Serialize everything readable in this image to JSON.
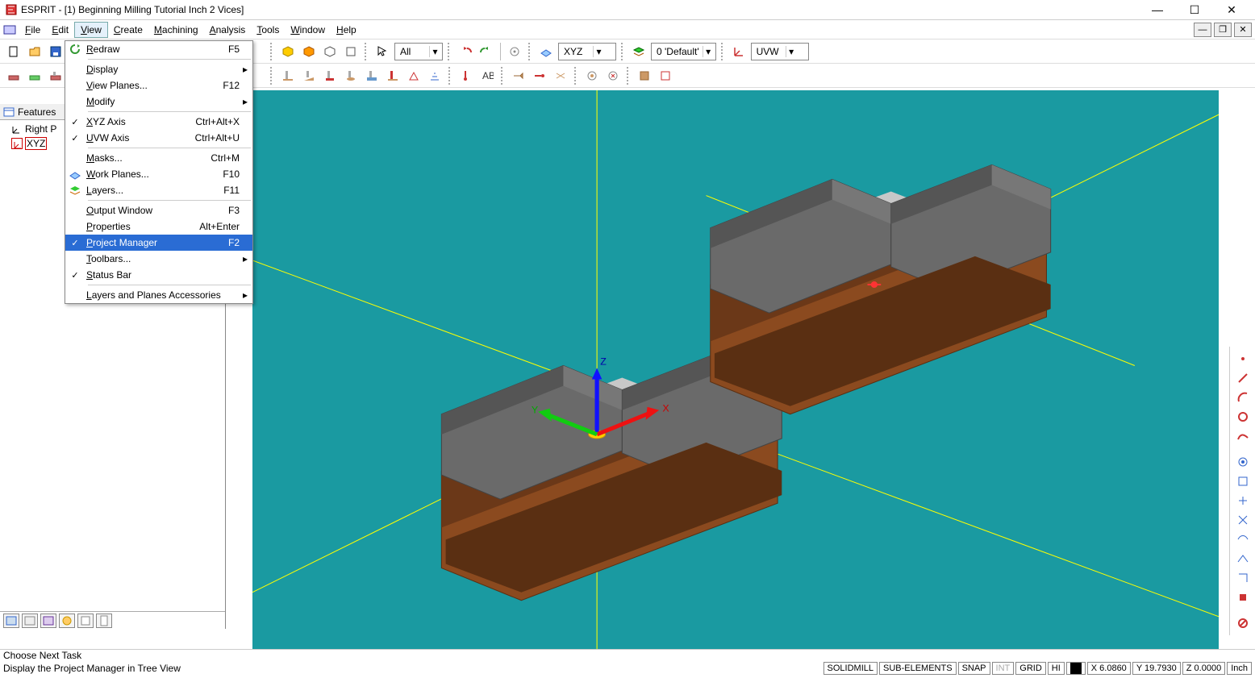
{
  "title": "ESPRIT - [1) Beginning Milling Tutorial Inch 2 Vices]",
  "menubar": [
    "File",
    "Edit",
    "View",
    "Create",
    "Machining",
    "Analysis",
    "Tools",
    "Window",
    "Help"
  ],
  "toolbar1": {
    "filter_combo": "All",
    "plane_combo": "XYZ",
    "layer_combo": "0 'Default'",
    "uvw_combo": "UVW"
  },
  "features": {
    "header": "Features",
    "items": [
      {
        "label": "Right P",
        "sel": false
      },
      {
        "label": "XYZ",
        "sel": true
      }
    ]
  },
  "view_menu": [
    {
      "type": "item",
      "icon": "redraw",
      "label": "Redraw",
      "accel": "F5"
    },
    {
      "type": "sep"
    },
    {
      "type": "item",
      "label": "Display",
      "sub": true
    },
    {
      "type": "item",
      "label": "View Planes...",
      "accel": "F12"
    },
    {
      "type": "item",
      "label": "Modify",
      "sub": true
    },
    {
      "type": "sep"
    },
    {
      "type": "item",
      "check": true,
      "label": "XYZ Axis",
      "accel": "Ctrl+Alt+X"
    },
    {
      "type": "item",
      "check": true,
      "label": "UVW Axis",
      "accel": "Ctrl+Alt+U"
    },
    {
      "type": "sep"
    },
    {
      "type": "item",
      "label": "Masks...",
      "accel": "Ctrl+M"
    },
    {
      "type": "item",
      "icon": "workplane",
      "label": "Work Planes...",
      "accel": "F10"
    },
    {
      "type": "item",
      "icon": "layers",
      "label": "Layers...",
      "accel": "F11"
    },
    {
      "type": "sep"
    },
    {
      "type": "item",
      "label": "Output Window",
      "accel": "F3"
    },
    {
      "type": "item",
      "label": "Properties",
      "accel": "Alt+Enter"
    },
    {
      "type": "item",
      "check": true,
      "label": "Project Manager",
      "accel": "F2",
      "hl": true
    },
    {
      "type": "item",
      "label": "Toolbars...",
      "sub": true
    },
    {
      "type": "item",
      "check": true,
      "label": "Status Bar"
    },
    {
      "type": "sep"
    },
    {
      "type": "item",
      "label": "Layers and Planes Accessories",
      "sub": true
    }
  ],
  "status": {
    "line1": "Choose Next Task",
    "line2": "Display the Project Manager in Tree View",
    "mode": "SOLIDMILL",
    "sub": "SUB-ELEMENTS",
    "snap": "SNAP",
    "int": "INT",
    "grid": "GRID",
    "hi": "HI",
    "x": "X 6.0860",
    "y": "Y 19.7930",
    "z": "Z 0.0000",
    "units": "Inch"
  }
}
